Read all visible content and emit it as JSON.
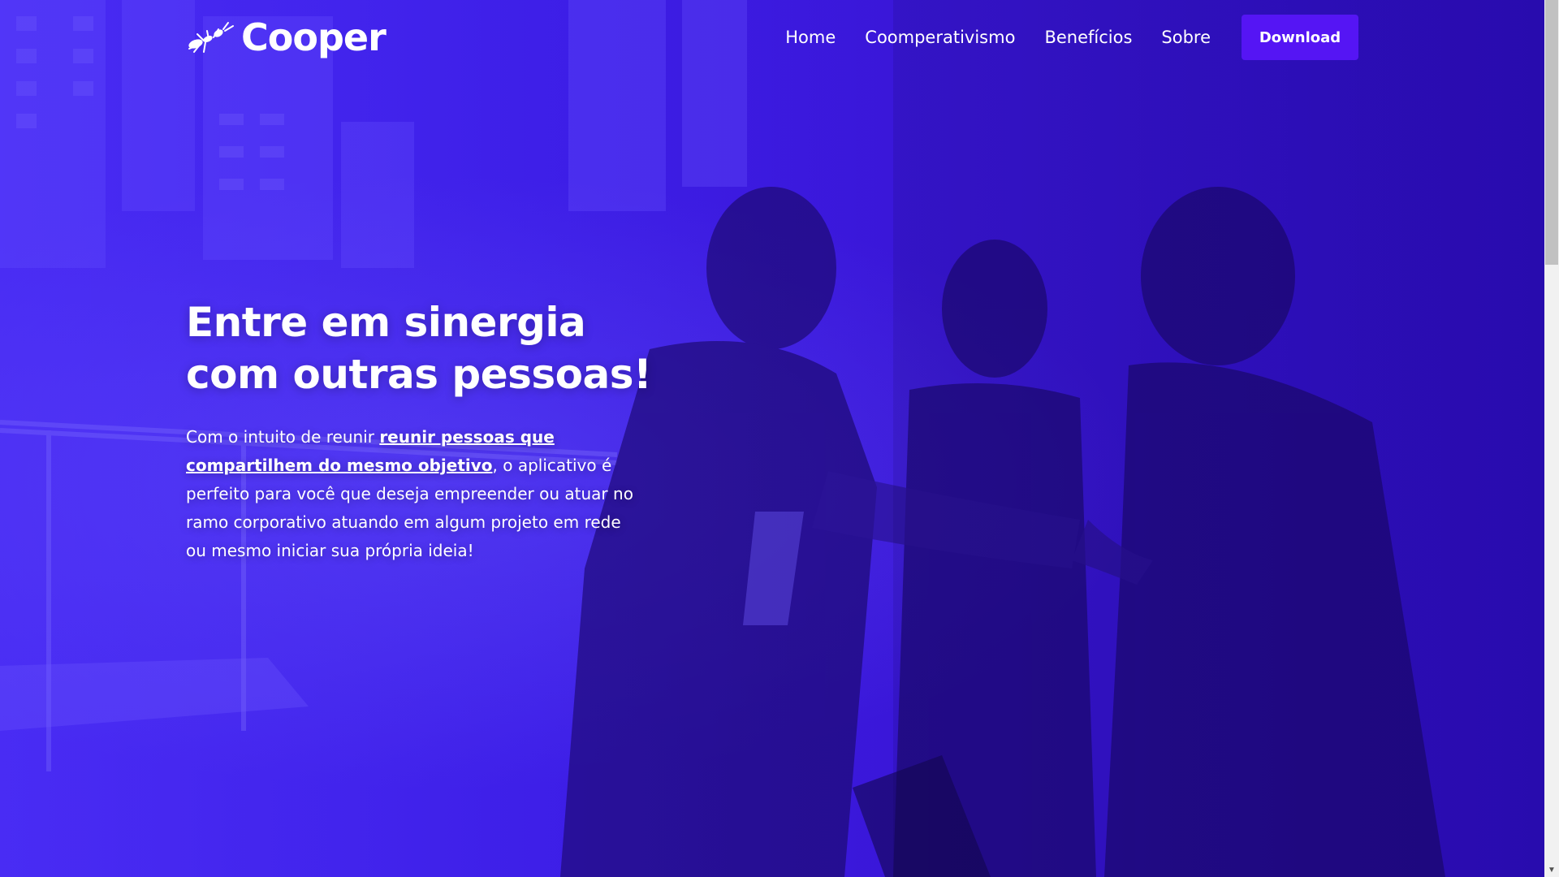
{
  "brand": {
    "name": "Cooper",
    "logo_icon": "ant-icon"
  },
  "nav": {
    "items": [
      {
        "label": "Home"
      },
      {
        "label": "Coomperativismo"
      },
      {
        "label": "Benefícios"
      },
      {
        "label": "Sobre"
      }
    ],
    "download_label": "Download"
  },
  "hero": {
    "title_line1": "Entre em sinergia",
    "title_line2": "com outras pessoas!",
    "text_before": "Com o intuito de reunir ",
    "text_link": "reunir pessoas que compartilhem do mesmo objetivo",
    "text_after": ", o aplicativo é perfeito para você que deseja empreender ou atuar no ramo corporativo atuando em algum projeto em rede ou mesmo iniciar sua própria ideia!"
  },
  "colors": {
    "overlay": "#3b18e0",
    "button": "#5515f4",
    "text": "#ffffff"
  }
}
